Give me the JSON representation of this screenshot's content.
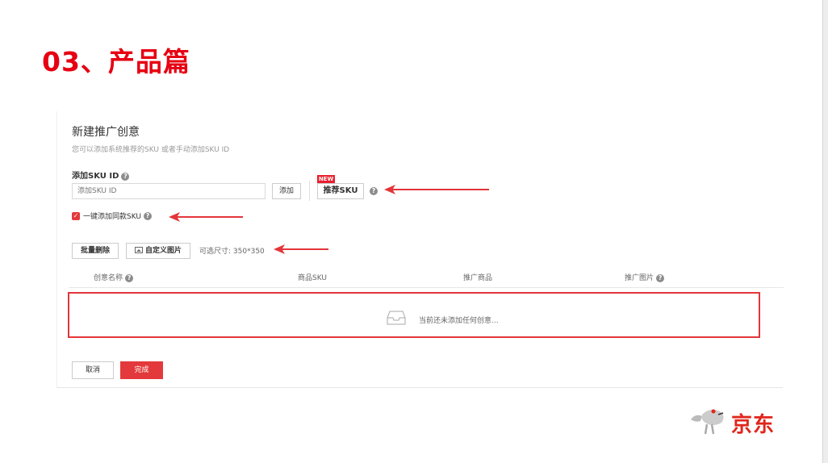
{
  "slide": {
    "title": "03、产品篇"
  },
  "panel": {
    "title": "新建推广创意",
    "subtitle": "您可以添加系统推荐的SKU 或者手动添加SKU ID",
    "sku_label": "添加SKU ID",
    "sku_placeholder": "添加SKU ID",
    "add_label": "添加",
    "new_badge": "NEW",
    "recommend_label": "推荐SKU",
    "same_sku_label": "一键添加同款SKU",
    "same_sku_checked": true,
    "batch_delete_label": "批量删除",
    "custom_image_label": "自定义图片",
    "size_hint_label": "可选尺寸:",
    "size_hint_value": "350*350",
    "columns": [
      "创意名称",
      "商品SKU",
      "推广商品",
      "推广图片"
    ],
    "empty_text": "当前还未添加任何创意...",
    "cancel_label": "取消",
    "finish_label": "完成"
  },
  "colors": {
    "accent": "#e60012",
    "button_red": "#e4393c",
    "highlight_border": "#e3353a"
  },
  "logo": {
    "text": "京东"
  }
}
